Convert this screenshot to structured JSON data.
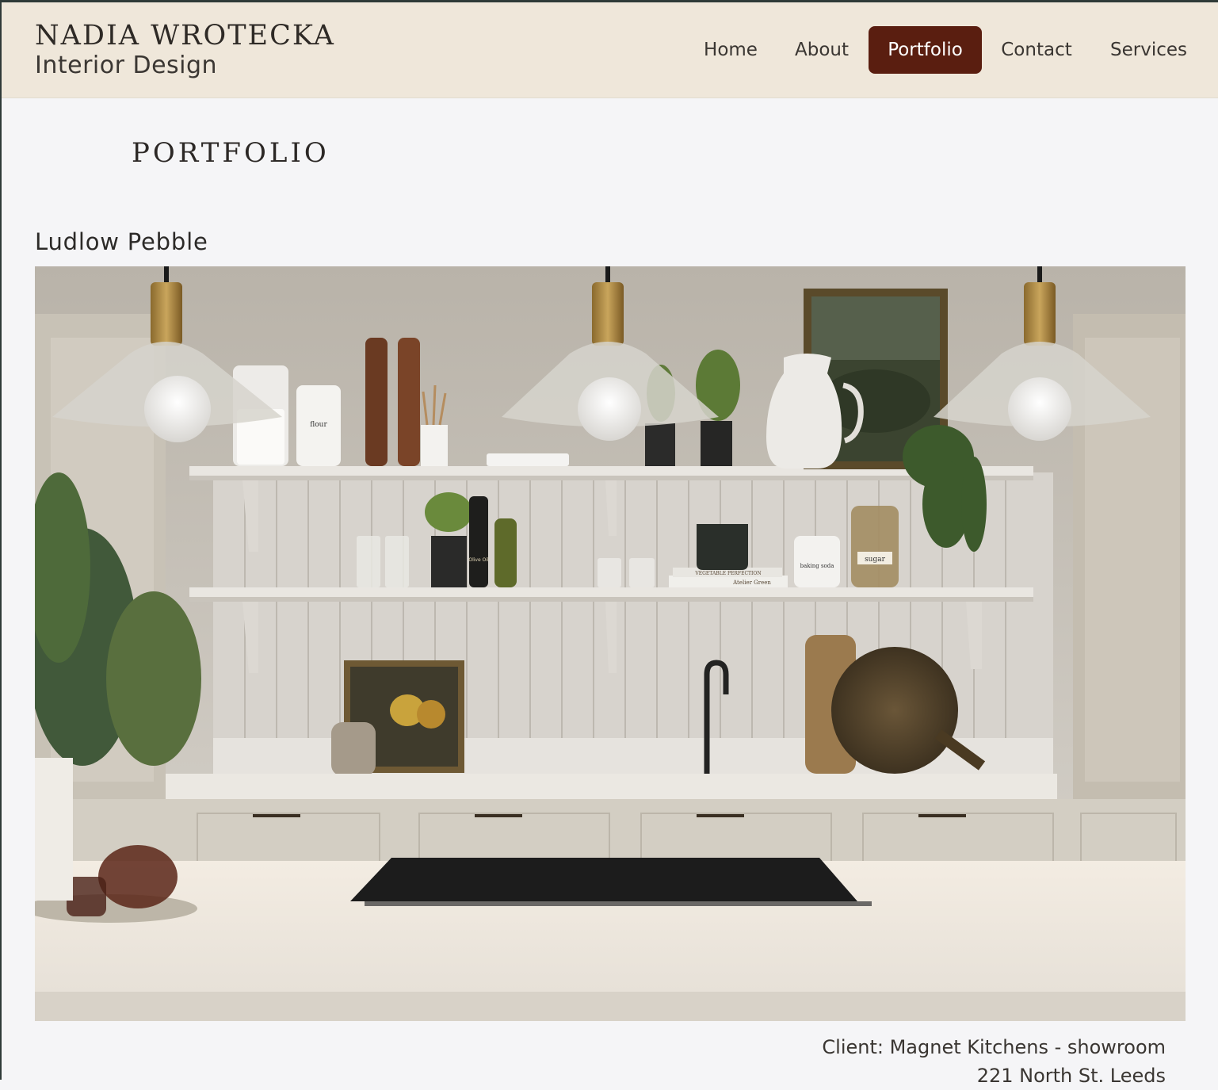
{
  "brand": {
    "name": "NADIA WROTECKA",
    "subtitle": "Interior Design"
  },
  "nav": {
    "items": [
      {
        "label": "Home",
        "active": false
      },
      {
        "label": "About",
        "active": false
      },
      {
        "label": "Portfolio",
        "active": true
      },
      {
        "label": "Contact",
        "active": false
      },
      {
        "label": "Services",
        "active": false
      }
    ]
  },
  "page": {
    "title": "PORTFOLIO"
  },
  "project": {
    "title": "Ludlow Pebble",
    "client_line": "Client: Magnet Kitchens - showroom",
    "address_line": "221 North St. Leeds",
    "image_labels": {
      "flour": "flour",
      "sugar": "sugar",
      "baking_soda": "baking soda",
      "olive_oil": "Olive Oil",
      "book_title": "VEGETABLE PERFECTION",
      "book_author": "Atelier Green"
    }
  },
  "colors": {
    "header_bg": "#efe7da",
    "accent": "#5a1e10",
    "page_bg": "#f5f5f7"
  }
}
